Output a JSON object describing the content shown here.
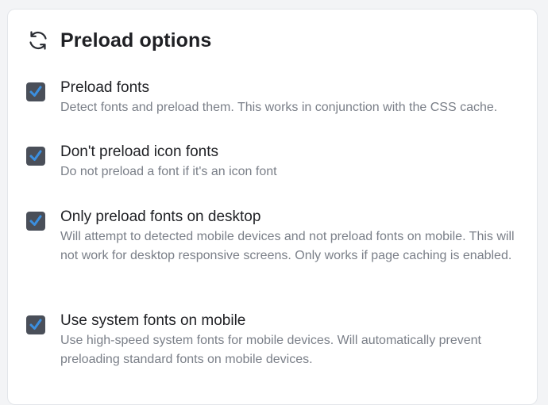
{
  "section": {
    "title": "Preload options",
    "icon": "refresh-icon"
  },
  "colors": {
    "checkbox_bg": "#4a4f59",
    "check_mark": "#3b8fe0",
    "title_text": "#1f2024",
    "desc_text": "#7a7f88"
  },
  "options": [
    {
      "label": "Preload fonts",
      "description": "Detect fonts and preload them. This works in conjunction with the CSS cache.",
      "checked": true
    },
    {
      "label": "Don't preload icon fonts",
      "description": "Do not preload a font if it's an icon font",
      "checked": true
    },
    {
      "label": "Only preload fonts on desktop",
      "description": "Will attempt to detected mobile devices and not preload fonts on mobile. This will not work for desktop responsive screens. Only works if page caching is enabled.",
      "checked": true
    },
    {
      "label": "Use system fonts on mobile",
      "description": "Use high-speed system fonts for mobile devices. Will automatically prevent preloading standard fonts on mobile devices.",
      "checked": true
    }
  ]
}
